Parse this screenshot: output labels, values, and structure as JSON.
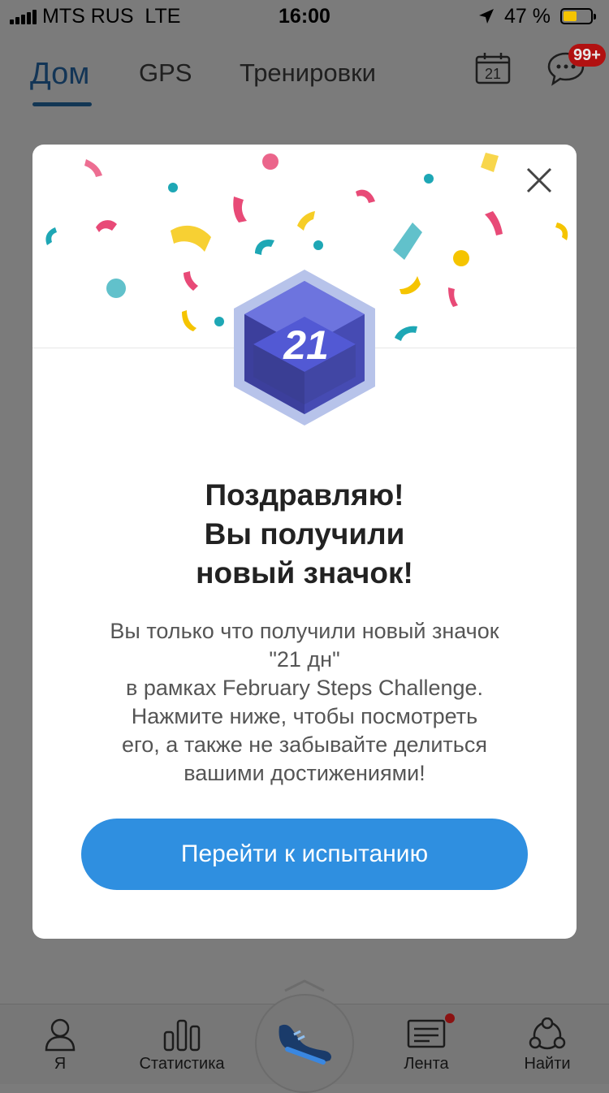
{
  "status_bar": {
    "carrier": "MTS RUS",
    "network": "LTE",
    "time": "16:00",
    "battery_percent": "47 %",
    "battery_color": "#f5c400"
  },
  "top_nav": {
    "tabs": [
      {
        "label": "Дом",
        "active": true
      },
      {
        "label": "GPS",
        "active": false
      },
      {
        "label": "Тренировки",
        "active": false
      }
    ],
    "calendar_day": "21",
    "chat_badge": "99+"
  },
  "bottom_nav": {
    "items": [
      {
        "label": "Я",
        "icon": "person-icon"
      },
      {
        "label": "Статистика",
        "icon": "bar-chart-icon"
      },
      {
        "label": "",
        "icon": "shoe-icon"
      },
      {
        "label": "Лента",
        "icon": "feed-icon"
      },
      {
        "label": "Найти",
        "icon": "people-network-icon"
      }
    ]
  },
  "modal": {
    "badge_number": "21",
    "title_lines": [
      "Поздравляю!",
      "Вы получили",
      "новый значок!"
    ],
    "body_lines": [
      "Вы только что получили новый значок",
      "\"21 дн\"",
      "в рамках February Steps Challenge.",
      "Нажмите ниже, чтобы посмотреть",
      "его, а также не забывайте делиться",
      "вашими достижениями!"
    ],
    "cta_label": "Перейти к испытанию",
    "accent_color": "#2f8fe0"
  }
}
